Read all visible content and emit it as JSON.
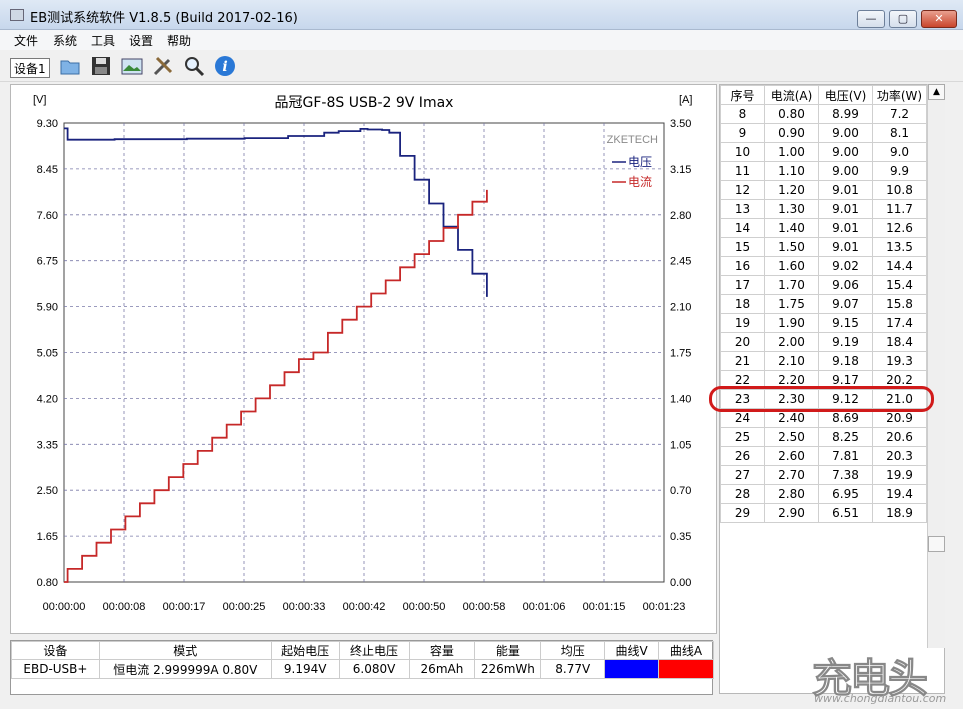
{
  "window": {
    "title": "EB测试系统软件 V1.8.5 (Build 2017-02-16)",
    "min": "—",
    "max": "▢",
    "close": "✕"
  },
  "menu": [
    "文件",
    "系统",
    "工具",
    "设置",
    "帮助"
  ],
  "toolbar": {
    "device": "设备1",
    "buttons": [
      "folder-icon",
      "save-icon",
      "image-icon",
      "tools-icon",
      "zoom-icon",
      "info-icon"
    ]
  },
  "chart_data": {
    "type": "line",
    "title": "品冠GF-8S USB-2  9V Imax",
    "watermark": "ZKETECH",
    "left_unit": "[V]",
    "right_unit": "[A]",
    "left_ticks": [
      "9.30",
      "8.45",
      "7.60",
      "6.75",
      "5.90",
      "5.05",
      "4.20",
      "3.35",
      "2.50",
      "1.65",
      "0.80"
    ],
    "right_ticks": [
      "3.50",
      "3.15",
      "2.80",
      "2.45",
      "2.10",
      "1.75",
      "1.40",
      "1.05",
      "0.70",
      "0.35",
      "0.00"
    ],
    "x_ticks": [
      "00:00:00",
      "00:00:08",
      "00:00:17",
      "00:00:25",
      "00:00:33",
      "00:00:42",
      "00:00:50",
      "00:00:58",
      "00:01:06",
      "00:01:15",
      "00:01:23"
    ],
    "ylim_v": [
      0.8,
      9.3
    ],
    "ylim_a": [
      0.0,
      3.5
    ],
    "xlim_s": [
      0,
      83
    ],
    "grid": true,
    "legend_position": "top-right",
    "series": [
      {
        "name": "电压",
        "color": "#1a237e",
        "points": [
          [
            0,
            9.2
          ],
          [
            0.5,
            9.2
          ],
          [
            0.5,
            8.99
          ],
          [
            7,
            8.99
          ],
          [
            7,
            9.0
          ],
          [
            17,
            9.0
          ],
          [
            17,
            9.01
          ],
          [
            25,
            9.01
          ],
          [
            25,
            9.02
          ],
          [
            31,
            9.02
          ],
          [
            31,
            9.06
          ],
          [
            36,
            9.06
          ],
          [
            36,
            9.12
          ],
          [
            38,
            9.12
          ],
          [
            38,
            9.15
          ],
          [
            41,
            9.15
          ],
          [
            41,
            9.19
          ],
          [
            42,
            9.19
          ],
          [
            42,
            9.18
          ],
          [
            44,
            9.18
          ],
          [
            44,
            9.17
          ],
          [
            45,
            9.17
          ],
          [
            45,
            9.12
          ],
          [
            46.5,
            9.12
          ],
          [
            46.5,
            8.69
          ],
          [
            48.5,
            8.69
          ],
          [
            48.5,
            8.25
          ],
          [
            50.5,
            8.25
          ],
          [
            50.5,
            7.81
          ],
          [
            52.5,
            7.81
          ],
          [
            52.5,
            7.38
          ],
          [
            54.5,
            7.38
          ],
          [
            54.5,
            6.95
          ],
          [
            56.5,
            6.95
          ],
          [
            56.5,
            6.51
          ],
          [
            58.5,
            6.51
          ],
          [
            58.5,
            6.08
          ]
        ]
      },
      {
        "name": "电流",
        "color": "#c62828",
        "points": [
          [
            0,
            0.0
          ],
          [
            0.5,
            0.0
          ],
          [
            0.5,
            0.1
          ],
          [
            2.5,
            0.1
          ],
          [
            2.5,
            0.2
          ],
          [
            4.5,
            0.2
          ],
          [
            4.5,
            0.3
          ],
          [
            6.5,
            0.3
          ],
          [
            6.5,
            0.4
          ],
          [
            8.5,
            0.4
          ],
          [
            8.5,
            0.5
          ],
          [
            10.5,
            0.5
          ],
          [
            10.5,
            0.6
          ],
          [
            12.5,
            0.6
          ],
          [
            12.5,
            0.7
          ],
          [
            14.5,
            0.7
          ],
          [
            14.5,
            0.8
          ],
          [
            16.5,
            0.8
          ],
          [
            16.5,
            0.9
          ],
          [
            18.5,
            0.9
          ],
          [
            18.5,
            1.0
          ],
          [
            20.5,
            1.0
          ],
          [
            20.5,
            1.1
          ],
          [
            22.5,
            1.1
          ],
          [
            22.5,
            1.2
          ],
          [
            24.5,
            1.2
          ],
          [
            24.5,
            1.3
          ],
          [
            26.5,
            1.3
          ],
          [
            26.5,
            1.4
          ],
          [
            28.5,
            1.4
          ],
          [
            28.5,
            1.5
          ],
          [
            30.5,
            1.5
          ],
          [
            30.5,
            1.6
          ],
          [
            32.5,
            1.6
          ],
          [
            32.5,
            1.7
          ],
          [
            34.5,
            1.7
          ],
          [
            34.5,
            1.75
          ],
          [
            36.5,
            1.75
          ],
          [
            36.5,
            1.9
          ],
          [
            38.5,
            1.9
          ],
          [
            38.5,
            2.0
          ],
          [
            40.5,
            2.0
          ],
          [
            40.5,
            2.1
          ],
          [
            42.5,
            2.1
          ],
          [
            42.5,
            2.2
          ],
          [
            44.5,
            2.2
          ],
          [
            44.5,
            2.3
          ],
          [
            46.5,
            2.3
          ],
          [
            46.5,
            2.4
          ],
          [
            48.5,
            2.4
          ],
          [
            48.5,
            2.5
          ],
          [
            50.5,
            2.5
          ],
          [
            50.5,
            2.6
          ],
          [
            52.5,
            2.6
          ],
          [
            52.5,
            2.7
          ],
          [
            54.5,
            2.7
          ],
          [
            54.5,
            2.8
          ],
          [
            56.5,
            2.8
          ],
          [
            56.5,
            2.9
          ],
          [
            58.5,
            2.9
          ],
          [
            58.5,
            2.99
          ]
        ]
      }
    ]
  },
  "table": {
    "headers": [
      "序号",
      "电流(A)",
      "电压(V)",
      "功率(W)"
    ],
    "rows": [
      [
        "8",
        "0.80",
        "8.99",
        "7.2"
      ],
      [
        "9",
        "0.90",
        "9.00",
        "8.1"
      ],
      [
        "10",
        "1.00",
        "9.00",
        "9.0"
      ],
      [
        "11",
        "1.10",
        "9.00",
        "9.9"
      ],
      [
        "12",
        "1.20",
        "9.01",
        "10.8"
      ],
      [
        "13",
        "1.30",
        "9.01",
        "11.7"
      ],
      [
        "14",
        "1.40",
        "9.01",
        "12.6"
      ],
      [
        "15",
        "1.50",
        "9.01",
        "13.5"
      ],
      [
        "16",
        "1.60",
        "9.02",
        "14.4"
      ],
      [
        "17",
        "1.70",
        "9.06",
        "15.4"
      ],
      [
        "18",
        "1.75",
        "9.07",
        "15.8"
      ],
      [
        "19",
        "1.90",
        "9.15",
        "17.4"
      ],
      [
        "20",
        "2.00",
        "9.19",
        "18.4"
      ],
      [
        "21",
        "2.10",
        "9.18",
        "19.3"
      ],
      [
        "22",
        "2.20",
        "9.17",
        "20.2"
      ],
      [
        "23",
        "2.30",
        "9.12",
        "21.0"
      ],
      [
        "24",
        "2.40",
        "8.69",
        "20.9"
      ],
      [
        "25",
        "2.50",
        "8.25",
        "20.6"
      ],
      [
        "26",
        "2.60",
        "7.81",
        "20.3"
      ],
      [
        "27",
        "2.70",
        "7.38",
        "19.9"
      ],
      [
        "28",
        "2.80",
        "6.95",
        "19.4"
      ],
      [
        "29",
        "2.90",
        "6.51",
        "18.9"
      ]
    ],
    "highlight_row": 15
  },
  "summary": {
    "headers": [
      "设备",
      "模式",
      "起始电压",
      "终止电压",
      "容量",
      "能量",
      "均压",
      "曲线V",
      "曲线A"
    ],
    "values": [
      "EBD-USB+",
      "恒电流  2.999999A  0.80V",
      "9.194V",
      "6.080V",
      "26mAh",
      "226mWh",
      "8.77V"
    ],
    "swatch_v": "#0000ff",
    "swatch_a": "#ff0000"
  },
  "watermark": {
    "big": "充电头",
    "small": "www.chongdiantou.com"
  }
}
